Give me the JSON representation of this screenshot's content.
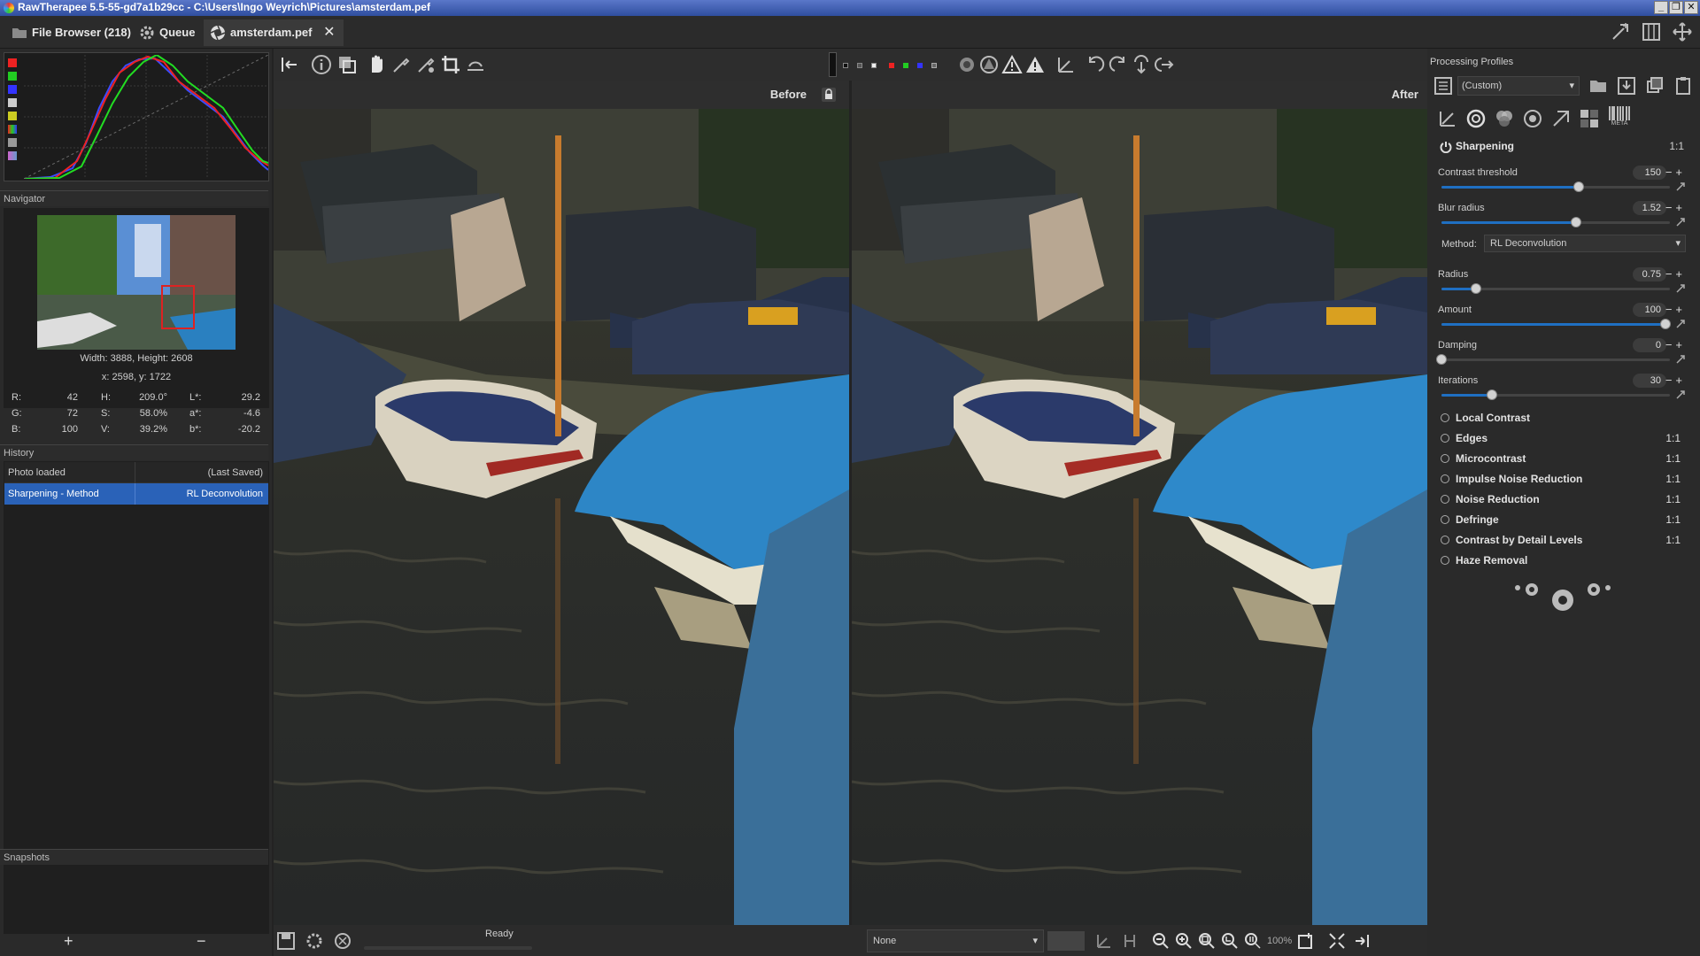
{
  "window": {
    "title": "RawTherapee 5.5-55-gd7a1b29cc - C:\\Users\\Ingo Weyrich\\Pictures\\amsterdam.pef"
  },
  "tabs": [
    {
      "label": "File Browser (218)",
      "icon": "folder-icon"
    },
    {
      "label": "Queue",
      "icon": "gear-icon"
    },
    {
      "label": "amsterdam.pef",
      "icon": "aperture-icon"
    }
  ],
  "left": {
    "navigator_title": "Navigator",
    "dims": "Width: 3888, Height: 2608",
    "coords": "x: 2598, y: 1722",
    "pixel": {
      "r_lbl": "R:",
      "r": "42",
      "g_lbl": "G:",
      "g": "72",
      "b_lbl": "B:",
      "b": "100",
      "h_lbl": "H:",
      "h": "209.0°",
      "s_lbl": "S:",
      "s": "58.0%",
      "v_lbl": "V:",
      "v": "39.2%",
      "l_lbl": "L*:",
      "l": "29.2",
      "a_lbl": "a*:",
      "a": "-4.6",
      "bb_lbl": "b*:",
      "bb": "-20.2"
    },
    "history_title": "History",
    "history": [
      {
        "action": "Photo loaded",
        "value": "(Last Saved)"
      },
      {
        "action": "Sharpening - Method",
        "value": "RL Deconvolution"
      }
    ],
    "snapshots_title": "Snapshots",
    "snap_add": "+",
    "snap_remove": "−"
  },
  "viewer": {
    "before_label": "Before",
    "after_label": "After",
    "status": "Ready",
    "crop_guide": "None",
    "zoom": "100%"
  },
  "right": {
    "profiles_title": "Processing Profiles",
    "profile_value": "(Custom)",
    "meta_label": "META",
    "sharpening": {
      "title": "Sharpening",
      "ratio": "1:1",
      "sliders": [
        {
          "label": "Contrast threshold",
          "value": "150",
          "pos": 0.6
        },
        {
          "label": "Blur radius",
          "value": "1.52",
          "pos": 0.59
        },
        {
          "label": "Radius",
          "value": "0.75",
          "pos": 0.15
        },
        {
          "label": "Amount",
          "value": "100",
          "pos": 0.98
        },
        {
          "label": "Damping",
          "value": "0",
          "pos": 0.0
        },
        {
          "label": "Iterations",
          "value": "30",
          "pos": 0.22
        }
      ],
      "method_label": "Method:",
      "method_value": "RL Deconvolution"
    },
    "tools": [
      {
        "label": "Local Contrast",
        "ratio": ""
      },
      {
        "label": "Edges",
        "ratio": "1:1"
      },
      {
        "label": "Microcontrast",
        "ratio": "1:1"
      },
      {
        "label": "Impulse Noise Reduction",
        "ratio": "1:1"
      },
      {
        "label": "Noise Reduction",
        "ratio": "1:1"
      },
      {
        "label": "Defringe",
        "ratio": "1:1"
      },
      {
        "label": "Contrast by Detail Levels",
        "ratio": "1:1"
      },
      {
        "label": "Haze Removal",
        "ratio": ""
      }
    ]
  },
  "colors": {
    "accent": "#1f6fc2",
    "selection": "#2a62b8",
    "panel": "#2a2a2a"
  }
}
